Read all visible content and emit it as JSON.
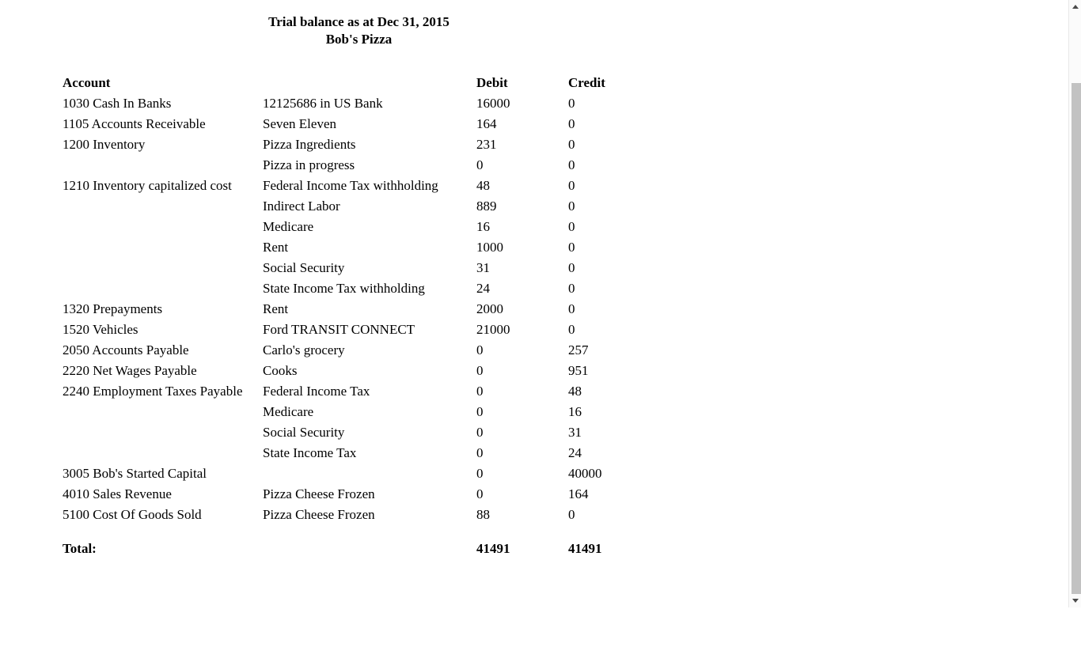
{
  "document": {
    "title_lines": [
      "Trial balance as at Dec 31, 2015",
      "Bob's Pizza"
    ]
  },
  "table": {
    "headers": {
      "account": "Account",
      "description": "",
      "debit": "Debit",
      "credit": "Credit"
    },
    "rows": [
      {
        "account": "1030 Cash In Banks",
        "description": "12125686 in US Bank",
        "debit": "16000",
        "credit": "0"
      },
      {
        "account": "1105 Accounts Receivable",
        "description": "Seven Eleven",
        "debit": "164",
        "credit": "0"
      },
      {
        "account": "1200 Inventory",
        "description": "Pizza Ingredients",
        "debit": "231",
        "credit": "0"
      },
      {
        "account": "",
        "description": "Pizza in progress",
        "debit": "0",
        "credit": "0"
      },
      {
        "account": "1210 Inventory capitalized cost",
        "description": "Federal Income Tax withholding",
        "debit": "48",
        "credit": "0"
      },
      {
        "account": "",
        "description": "Indirect Labor",
        "debit": "889",
        "credit": "0"
      },
      {
        "account": "",
        "description": "Medicare",
        "debit": "16",
        "credit": "0"
      },
      {
        "account": "",
        "description": "Rent",
        "debit": "1000",
        "credit": "0"
      },
      {
        "account": "",
        "description": "Social Security",
        "debit": "31",
        "credit": "0"
      },
      {
        "account": "",
        "description": "State Income Tax withholding",
        "debit": "24",
        "credit": "0"
      },
      {
        "account": "1320 Prepayments",
        "description": "Rent",
        "debit": "2000",
        "credit": "0"
      },
      {
        "account": "1520 Vehicles",
        "description": "Ford TRANSIT CONNECT",
        "debit": "21000",
        "credit": "0"
      },
      {
        "account": "2050 Accounts Payable",
        "description": "Carlo's grocery",
        "debit": "0",
        "credit": "257"
      },
      {
        "account": "2220 Net Wages Payable",
        "description": "Cooks",
        "debit": "0",
        "credit": "951"
      },
      {
        "account": "2240 Employment Taxes Payable",
        "description": "Federal Income Tax",
        "debit": "0",
        "credit": "48"
      },
      {
        "account": "",
        "description": "Medicare",
        "debit": "0",
        "credit": "16"
      },
      {
        "account": "",
        "description": "Social Security",
        "debit": "0",
        "credit": "31"
      },
      {
        "account": "",
        "description": "State Income Tax",
        "debit": "0",
        "credit": "24"
      },
      {
        "account": "3005 Bob's Started Capital",
        "description": "",
        "debit": "0",
        "credit": "40000"
      },
      {
        "account": "4010 Sales Revenue",
        "description": "Pizza Cheese Frozen",
        "debit": "0",
        "credit": "164"
      },
      {
        "account": "5100 Cost Of Goods Sold",
        "description": "Pizza Cheese Frozen",
        "debit": "88",
        "credit": "0"
      }
    ],
    "total": {
      "label": "Total:",
      "description": "",
      "debit": "41491",
      "credit": "41491"
    }
  },
  "scrollbar": {
    "up_arrow": "scroll-up-arrow",
    "down_arrow": "scroll-down-arrow"
  }
}
